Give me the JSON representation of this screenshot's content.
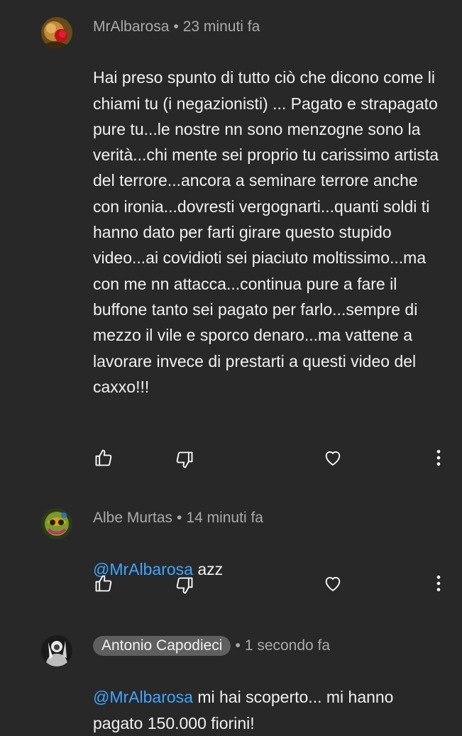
{
  "comments": [
    {
      "author": "MrAlbarosa",
      "separator": "•",
      "time": "23 minuti fa",
      "mention": "",
      "text": "Hai preso spunto di tutto ciò che dicono come li chiami tu (i negazionisti) ... Pagato e strapagato pure tu...le nostre nn sono menzogne sono la verità...chi mente sei proprio tu carissimo artista del terrore...ancora a seminare terrore anche con ironia...dovresti vergognarti...quanti soldi ti hanno dato per farti girare questo stupido video...ai covidioti sei piaciuto moltissimo...ma con me nn attacca...continua pure a fare il buffone tanto sei pagato per farlo...sempre di mezzo il vile e sporco denaro...ma vattene a lavorare invece di prestarti a questi video del caxxo!!!",
      "avatar_icon": "red-rose-avatar-icon"
    },
    {
      "author": "Albe Murtas",
      "separator": "•",
      "time": "14 minuti fa",
      "mention": "@MrAlbarosa",
      "text": "azz",
      "avatar_icon": "colorful-mask-avatar-icon"
    },
    {
      "author": "Antonio Capodieci",
      "separator": "•",
      "time": "1 secondo fa",
      "mention": "@MrAlbarosa",
      "text": "mi hai scoperto... mi hanno pagato 150.000 fiorini!",
      "avatar_icon": "bw-photo-avatar-icon"
    }
  ],
  "icons": {
    "like": "thumbs-up-icon",
    "dislike": "thumbs-down-icon",
    "heart": "heart-icon",
    "more": "more-vert-icon"
  },
  "colors": {
    "background": "#282828",
    "mention": "#3ea6ff",
    "meta": "#aaaaaa",
    "chip": "#5f5f5f"
  }
}
